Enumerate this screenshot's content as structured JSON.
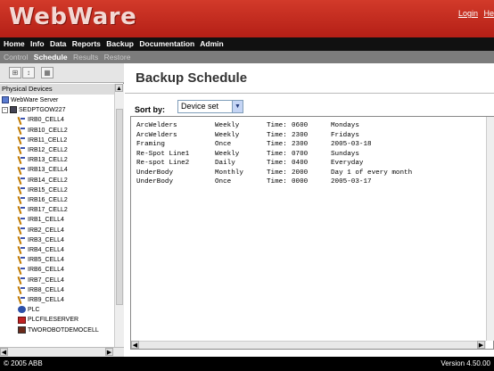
{
  "app": {
    "logo": "WebWare",
    "top_links": [
      "Login",
      "Hel"
    ]
  },
  "main_menu": [
    "Home",
    "Info",
    "Data",
    "Reports",
    "Backup",
    "Documentation",
    "Admin"
  ],
  "sub_menu": [
    {
      "label": "Control",
      "active": false
    },
    {
      "label": "Schedule",
      "active": true
    },
    {
      "label": "Results",
      "active": false
    },
    {
      "label": "Restore",
      "active": false
    }
  ],
  "tree_panel": {
    "header": "Physical Devices",
    "root": "WebWare Server",
    "station": "SEDPTGOW227",
    "robots": [
      "IRB0_CELL4",
      "IRB10_CELL2",
      "IRB11_CELL2",
      "IRB12_CELL2",
      "IRB13_CELL2",
      "IRB13_CELL4",
      "IRB14_CELL2",
      "IRB15_CELL2",
      "IRB16_CELL2",
      "IRB17_CELL2",
      "IRB1_CELL4",
      "IRB2_CELL4",
      "IRB3_CELL4",
      "IRB4_CELL4",
      "IRB5_CELL4",
      "IRB6_CELL4",
      "IRB7_CELL4",
      "IRB8_CELL4",
      "IRB9_CELL4"
    ],
    "others": [
      "PLC",
      "PLCFILESERVER",
      "TWOROBOTDEMOCELL"
    ]
  },
  "main": {
    "title": "Backup Schedule",
    "sort_label": "Sort by:",
    "sort_value": "Device set",
    "rows": [
      {
        "name": "ArcWelders",
        "freq": "Weekly",
        "time_label": "Time:",
        "time": "0600",
        "when": "Mondays"
      },
      {
        "name": "ArcWelders",
        "freq": "Weekly",
        "time_label": "Time:",
        "time": "2300",
        "when": "Fridays"
      },
      {
        "name": "Framing",
        "freq": "Once",
        "time_label": "Time:",
        "time": "2300",
        "when": "2005-03-18"
      },
      {
        "name": "Re-Spot Line1",
        "freq": "Weekly",
        "time_label": "Time:",
        "time": "0700",
        "when": "Sundays"
      },
      {
        "name": "Re-spot Line2",
        "freq": "Daily",
        "time_label": "Time:",
        "time": "0400",
        "when": "Everyday"
      },
      {
        "name": "UnderBody",
        "freq": "Monthly",
        "time_label": "Time:",
        "time": "2000",
        "when": "Day 1 of every month"
      },
      {
        "name": "UnderBody",
        "freq": "Once",
        "time_label": "Time:",
        "time": "0000",
        "when": "2005-03-17"
      }
    ]
  },
  "footer": {
    "copyright": "© 2005 ABB",
    "version": "Version 4.50.00"
  }
}
